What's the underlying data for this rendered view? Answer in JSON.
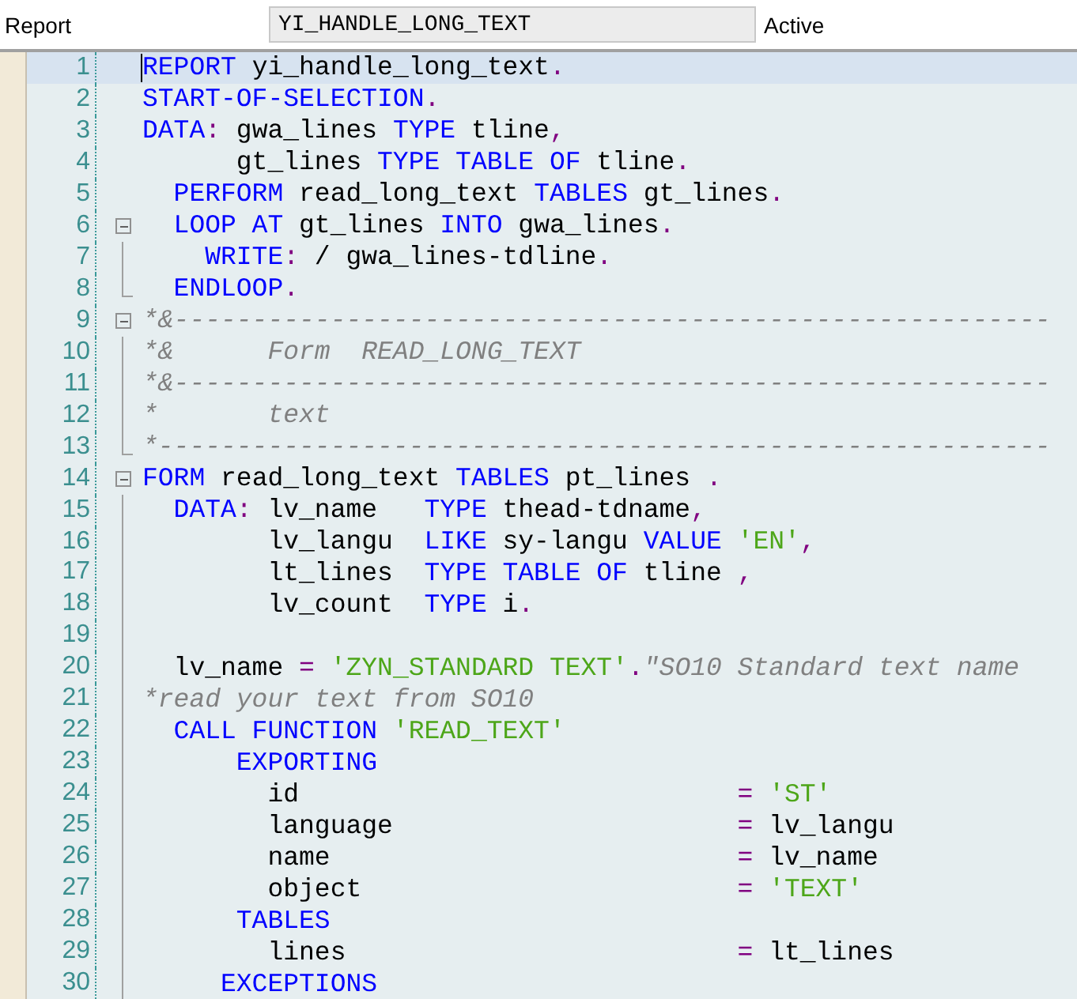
{
  "header": {
    "label": "Report",
    "program_name": "YI_HANDLE_LONG_TEXT",
    "status": "Active"
  },
  "lines": [
    {
      "number": "1",
      "current": true,
      "tokens": [
        {
          "kind": "keyword",
          "text": "REPORT"
        },
        {
          "kind": "name",
          "text": " yi_handle_long_text"
        },
        {
          "kind": "punct",
          "text": "."
        }
      ]
    },
    {
      "number": "2",
      "current": false,
      "tokens": [
        {
          "kind": "keyword",
          "text": "START-OF-SELECTION"
        },
        {
          "kind": "punct",
          "text": "."
        }
      ]
    },
    {
      "number": "3",
      "current": false,
      "tokens": [
        {
          "kind": "keyword",
          "text": "DATA"
        },
        {
          "kind": "punct",
          "text": ":"
        },
        {
          "kind": "name",
          "text": " gwa_lines "
        },
        {
          "kind": "keyword",
          "text": "TYPE"
        },
        {
          "kind": "name",
          "text": " tline"
        },
        {
          "kind": "punct",
          "text": ","
        }
      ]
    },
    {
      "number": "4",
      "current": false,
      "tokens": [
        {
          "kind": "name",
          "text": "      gt_lines "
        },
        {
          "kind": "keyword",
          "text": "TYPE TABLE OF"
        },
        {
          "kind": "name",
          "text": " tline"
        },
        {
          "kind": "punct",
          "text": "."
        }
      ]
    },
    {
      "number": "5",
      "current": false,
      "tokens": [
        {
          "kind": "keyword",
          "text": "  PERFORM"
        },
        {
          "kind": "name",
          "text": " read_long_text "
        },
        {
          "kind": "keyword",
          "text": "TABLES"
        },
        {
          "kind": "name",
          "text": " gt_lines"
        },
        {
          "kind": "punct",
          "text": "."
        }
      ]
    },
    {
      "number": "6",
      "current": false,
      "kind": "foldstart",
      "tokens": [
        {
          "kind": "keyword",
          "text": "  LOOP AT"
        },
        {
          "kind": "name",
          "text": " gt_lines "
        },
        {
          "kind": "keyword",
          "text": "INTO"
        },
        {
          "kind": "name",
          "text": " gwa_lines"
        },
        {
          "kind": "punct",
          "text": "."
        }
      ]
    },
    {
      "number": "7",
      "current": false,
      "kind": "foldbody",
      "tokens": [
        {
          "kind": "keyword",
          "text": "    WRITE"
        },
        {
          "kind": "punct",
          "text": ":"
        },
        {
          "kind": "name",
          "text": " / gwa_lines-tdline"
        },
        {
          "kind": "punct",
          "text": "."
        }
      ]
    },
    {
      "number": "8",
      "current": false,
      "kind": "foldend",
      "tokens": [
        {
          "kind": "keyword",
          "text": "  ENDLOOP"
        },
        {
          "kind": "punct",
          "text": "."
        }
      ]
    },
    {
      "number": "9",
      "current": false,
      "kind": "foldstart",
      "tokens": [
        {
          "kind": "comment",
          "text": "*&--------------------------------------------------------"
        }
      ]
    },
    {
      "number": "10",
      "current": false,
      "kind": "foldbody",
      "tokens": [
        {
          "kind": "comment",
          "text": "*&      Form  READ_LONG_TEXT"
        }
      ]
    },
    {
      "number": "11",
      "current": false,
      "kind": "foldbody",
      "tokens": [
        {
          "kind": "comment",
          "text": "*&--------------------------------------------------------"
        }
      ]
    },
    {
      "number": "12",
      "current": false,
      "kind": "foldbody",
      "tokens": [
        {
          "kind": "comment",
          "text": "*       text"
        }
      ]
    },
    {
      "number": "13",
      "current": false,
      "kind": "foldend",
      "tokens": [
        {
          "kind": "comment",
          "text": "*---------------------------------------------------------"
        }
      ]
    },
    {
      "number": "14",
      "current": false,
      "kind": "foldstart",
      "tokens": [
        {
          "kind": "keyword",
          "text": "FORM"
        },
        {
          "kind": "name",
          "text": " read_long_text "
        },
        {
          "kind": "keyword",
          "text": "TABLES"
        },
        {
          "kind": "name",
          "text": " pt_lines "
        },
        {
          "kind": "punct",
          "text": "."
        }
      ]
    },
    {
      "number": "15",
      "current": false,
      "kind": "foldbody",
      "tokens": [
        {
          "kind": "keyword",
          "text": "  DATA"
        },
        {
          "kind": "punct",
          "text": ":"
        },
        {
          "kind": "name",
          "text": " lv_name   "
        },
        {
          "kind": "keyword",
          "text": "TYPE"
        },
        {
          "kind": "name",
          "text": " thead-tdname"
        },
        {
          "kind": "punct",
          "text": ","
        }
      ]
    },
    {
      "number": "16",
      "current": false,
      "kind": "foldbody",
      "tokens": [
        {
          "kind": "name",
          "text": "        lv_langu  "
        },
        {
          "kind": "keyword",
          "text": "LIKE"
        },
        {
          "kind": "name",
          "text": " sy-langu "
        },
        {
          "kind": "keyword",
          "text": "VALUE"
        },
        {
          "kind": "string",
          "text": " 'EN'"
        },
        {
          "kind": "punct",
          "text": ","
        }
      ]
    },
    {
      "number": "17",
      "current": false,
      "kind": "foldbody",
      "tokens": [
        {
          "kind": "name",
          "text": "        lt_lines  "
        },
        {
          "kind": "keyword",
          "text": "TYPE TABLE OF"
        },
        {
          "kind": "name",
          "text": " tline "
        },
        {
          "kind": "punct",
          "text": ","
        }
      ]
    },
    {
      "number": "18",
      "current": false,
      "kind": "foldbody",
      "tokens": [
        {
          "kind": "name",
          "text": "        lv_count  "
        },
        {
          "kind": "keyword",
          "text": "TYPE"
        },
        {
          "kind": "name",
          "text": " i"
        },
        {
          "kind": "punct",
          "text": "."
        }
      ]
    },
    {
      "number": "19",
      "current": false,
      "kind": "foldbody"
    },
    {
      "number": "20",
      "current": false,
      "kind": "foldbody",
      "tokens": [
        {
          "kind": "name",
          "text": "  lv_name "
        },
        {
          "kind": "punct",
          "text": "="
        },
        {
          "kind": "string",
          "text": " 'ZYN_STANDARD TEXT'"
        },
        {
          "kind": "punct",
          "text": "."
        },
        {
          "kind": "comment",
          "text": "\"SO10 Standard text name"
        }
      ]
    },
    {
      "number": "21",
      "current": false,
      "kind": "foldbody",
      "tokens": [
        {
          "kind": "comment",
          "text": "*read your text from SO10"
        }
      ]
    },
    {
      "number": "22",
      "current": false,
      "kind": "foldbody",
      "tokens": [
        {
          "kind": "keyword",
          "text": "  CALL FUNCTION"
        },
        {
          "kind": "string",
          "text": " 'READ_TEXT'"
        }
      ]
    },
    {
      "number": "23",
      "current": false,
      "kind": "foldbody",
      "tokens": [
        {
          "kind": "keyword",
          "text": "      EXPORTING"
        }
      ]
    },
    {
      "number": "24",
      "current": false,
      "kind": "foldbody",
      "tokens": [
        {
          "kind": "name",
          "text": "        id                            "
        },
        {
          "kind": "punct",
          "text": "="
        },
        {
          "kind": "string",
          "text": " 'ST'"
        }
      ]
    },
    {
      "number": "25",
      "current": false,
      "kind": "foldbody",
      "tokens": [
        {
          "kind": "name",
          "text": "        language                      "
        },
        {
          "kind": "punct",
          "text": "="
        },
        {
          "kind": "name",
          "text": " lv_langu"
        }
      ]
    },
    {
      "number": "26",
      "current": false,
      "kind": "foldbody",
      "tokens": [
        {
          "kind": "name",
          "text": "        name                          "
        },
        {
          "kind": "punct",
          "text": "="
        },
        {
          "kind": "name",
          "text": " lv_name"
        }
      ]
    },
    {
      "number": "27",
      "current": false,
      "kind": "foldbody",
      "tokens": [
        {
          "kind": "name",
          "text": "        object                        "
        },
        {
          "kind": "punct",
          "text": "="
        },
        {
          "kind": "string",
          "text": " 'TEXT'"
        }
      ]
    },
    {
      "number": "28",
      "current": false,
      "kind": "foldbody",
      "tokens": [
        {
          "kind": "keyword",
          "text": "      TABLES"
        }
      ]
    },
    {
      "number": "29",
      "current": false,
      "kind": "foldbody",
      "tokens": [
        {
          "kind": "name",
          "text": "        lines                         "
        },
        {
          "kind": "punct",
          "text": "="
        },
        {
          "kind": "name",
          "text": " lt_lines"
        }
      ]
    },
    {
      "number": "30",
      "current": false,
      "kind": "foldbody",
      "tokens": [
        {
          "kind": "keyword",
          "text": "     EXCEPTIONS"
        }
      ]
    }
  ]
}
